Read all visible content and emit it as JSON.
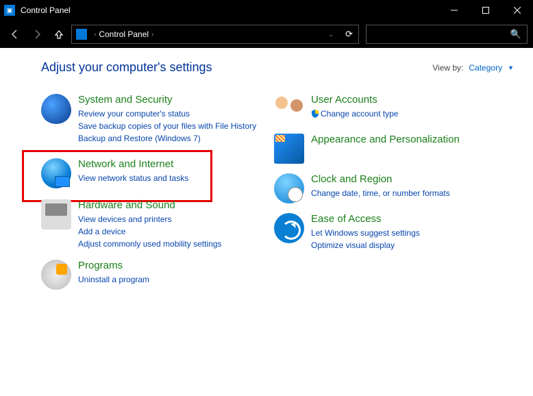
{
  "window": {
    "title": "Control Panel"
  },
  "breadcrumb": {
    "root": "Control Panel"
  },
  "header": {
    "title": "Adjust your computer's settings",
    "viewby_label": "View by:",
    "viewby_value": "Category"
  },
  "left": [
    {
      "title": "System and Security",
      "links": [
        "Review your computer's status",
        "Save backup copies of your files with File History",
        "Backup and Restore (Windows 7)"
      ]
    },
    {
      "title": "Network and Internet",
      "links": [
        "View network status and tasks"
      ],
      "highlighted": true
    },
    {
      "title": "Hardware and Sound",
      "links": [
        "View devices and printers",
        "Add a device",
        "Adjust commonly used mobility settings"
      ]
    },
    {
      "title": "Programs",
      "links": [
        "Uninstall a program"
      ]
    }
  ],
  "right": [
    {
      "title": "User Accounts",
      "links": [
        "Change account type"
      ],
      "shield_on_first": true
    },
    {
      "title": "Appearance and Personalization",
      "links": []
    },
    {
      "title": "Clock and Region",
      "links": [
        "Change date, time, or number formats"
      ]
    },
    {
      "title": "Ease of Access",
      "links": [
        "Let Windows suggest settings",
        "Optimize visual display"
      ]
    }
  ]
}
